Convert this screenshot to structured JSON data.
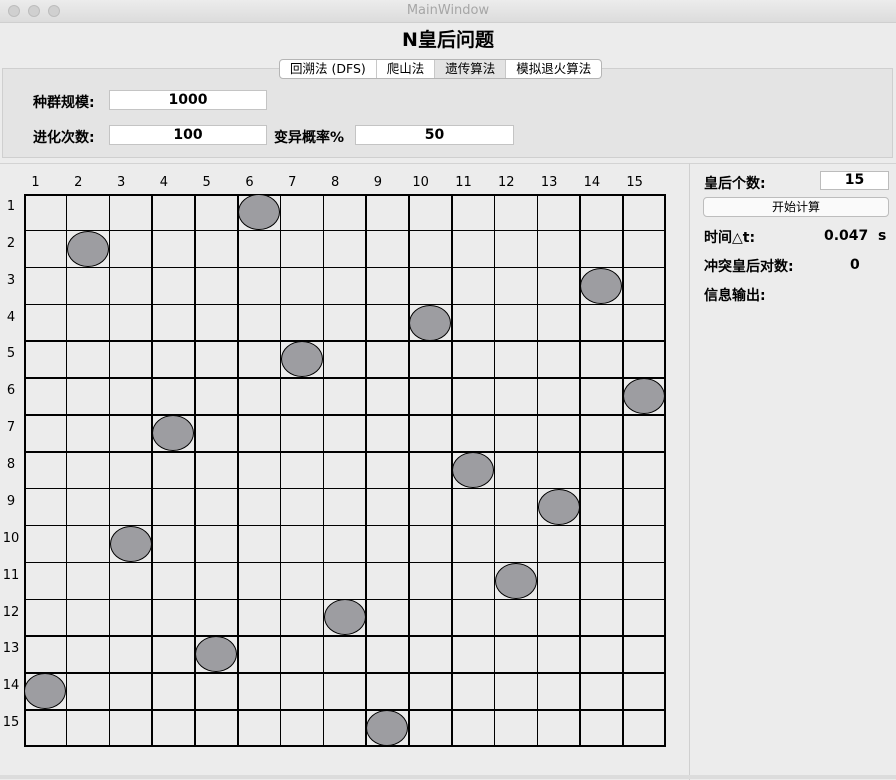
{
  "window": {
    "title": "MainWindow"
  },
  "app": {
    "title": "N皇后问题"
  },
  "tabs": [
    "回溯法 (DFS)",
    "爬山法",
    "遗传算法",
    "模拟退火算法"
  ],
  "active_tab": 2,
  "params": {
    "population_label": "种群规模:",
    "population_value": "1000",
    "generations_label": "进化次数:",
    "generations_value": "100",
    "mutation_label": "变异概率%",
    "mutation_value": "50"
  },
  "side": {
    "queen_count_label": "皇后个数:",
    "queen_count_value": "15",
    "start_button": "开始计算",
    "time_label": "时间△t:",
    "time_value": "0.047  s",
    "conflict_label": "冲突皇后对数:",
    "conflict_value": "0",
    "info_label": "信息输出:"
  },
  "board": {
    "size": 15,
    "col_labels": [
      "1",
      "2",
      "3",
      "4",
      "5",
      "6",
      "7",
      "8",
      "9",
      "10",
      "11",
      "12",
      "13",
      "14",
      "15"
    ],
    "row_labels": [
      "1",
      "2",
      "3",
      "4",
      "5",
      "6",
      "7",
      "8",
      "9",
      "10",
      "11",
      "12",
      "13",
      "14",
      "15"
    ],
    "queen_columns_by_row": [
      6,
      2,
      14,
      10,
      7,
      15,
      4,
      11,
      13,
      3,
      12,
      8,
      5,
      1,
      9
    ]
  }
}
